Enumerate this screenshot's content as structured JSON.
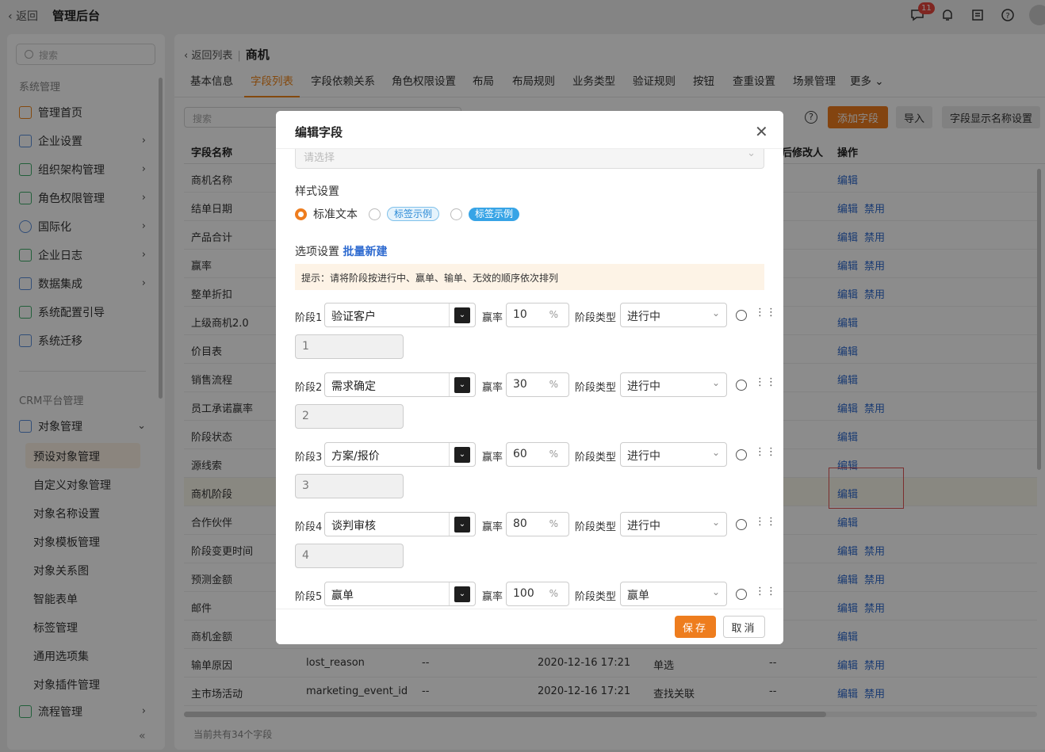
{
  "topbar": {
    "back_label": "返回",
    "app_title": "管理后台",
    "notification_count": "11"
  },
  "sidebar": {
    "search_placeholder": "搜索",
    "group_system": "系统管理",
    "system_items": [
      {
        "label": "管理首页",
        "icon": "home-icon"
      },
      {
        "label": "企业设置",
        "icon": "building-icon"
      },
      {
        "label": "组织架构管理",
        "icon": "org-icon"
      },
      {
        "label": "角色权限管理",
        "icon": "id-card-icon"
      },
      {
        "label": "国际化",
        "icon": "globe-icon"
      },
      {
        "label": "企业日志",
        "icon": "log-icon"
      },
      {
        "label": "数据集成",
        "icon": "chip-icon"
      },
      {
        "label": "系统配置引导",
        "icon": "guide-icon"
      },
      {
        "label": "系统迁移",
        "icon": "migrate-icon"
      }
    ],
    "group_crm": "CRM平台管理",
    "crm_parent": "对象管理",
    "crm_subitems": [
      "预设对象管理",
      "自定义对象管理",
      "对象名称设置",
      "对象模板管理",
      "对象关系图",
      "智能表单",
      "标签管理",
      "通用选项集",
      "对象插件管理"
    ],
    "crm_next": "流程管理"
  },
  "main": {
    "back_to_list": "返回列表",
    "entity_name": "商机",
    "tabs": [
      "基本信息",
      "字段列表",
      "字段依赖关系",
      "角色权限设置",
      "布局",
      "布局规则",
      "业务类型",
      "验证规则",
      "按钮",
      "查重设置",
      "场景管理",
      "更多"
    ],
    "search_placeholder": "搜索",
    "btn_add_field": "添加字段",
    "btn_import": "导入",
    "btn_display_name": "字段显示名称设置",
    "columns": {
      "name": "字段名称",
      "modifier": "后修改人",
      "action": "操作"
    },
    "rows": [
      {
        "name": "商机名称",
        "api": "",
        "c3": "",
        "time": "",
        "type": "",
        "mod": "",
        "edit": "编辑",
        "disable": ""
      },
      {
        "name": "结单日期",
        "api": "",
        "c3": "",
        "time": "",
        "type": "",
        "mod": "",
        "edit": "编辑",
        "disable": "禁用"
      },
      {
        "name": "产品合计",
        "api": "",
        "c3": "",
        "time": "",
        "type": "",
        "mod": "",
        "edit": "编辑",
        "disable": "禁用"
      },
      {
        "name": "赢率",
        "api": "",
        "c3": "",
        "time": "",
        "type": "",
        "mod": "",
        "edit": "编辑",
        "disable": "禁用"
      },
      {
        "name": "整单折扣",
        "api": "",
        "c3": "",
        "time": "",
        "type": "",
        "mod": "",
        "edit": "编辑",
        "disable": "禁用"
      },
      {
        "name": "上级商机2.0",
        "api": "",
        "c3": "",
        "time": "",
        "type": "",
        "mod": "",
        "edit": "编辑",
        "disable": ""
      },
      {
        "name": "价目表",
        "api": "",
        "c3": "",
        "time": "",
        "type": "",
        "mod": "",
        "edit": "编辑",
        "disable": ""
      },
      {
        "name": "销售流程",
        "api": "",
        "c3": "",
        "time": "",
        "type": "",
        "mod": "",
        "edit": "编辑",
        "disable": ""
      },
      {
        "name": "员工承诺赢率",
        "api": "",
        "c3": "",
        "time": "",
        "type": "",
        "mod": "",
        "edit": "编辑",
        "disable": "禁用"
      },
      {
        "name": "阶段状态",
        "api": "",
        "c3": "",
        "time": "",
        "type": "",
        "mod": "",
        "edit": "编辑",
        "disable": ""
      },
      {
        "name": "源线索",
        "api": "",
        "c3": "",
        "time": "",
        "type": "",
        "mod": "",
        "edit": "编辑",
        "disable": ""
      },
      {
        "name": "商机阶段",
        "api": "",
        "c3": "",
        "time": "",
        "type": "",
        "mod": "",
        "edit": "编辑",
        "disable": ""
      },
      {
        "name": "合作伙伴",
        "api": "",
        "c3": "",
        "time": "",
        "type": "",
        "mod": "",
        "edit": "编辑",
        "disable": ""
      },
      {
        "name": "阶段变更时间",
        "api": "",
        "c3": "",
        "time": "",
        "type": "",
        "mod": "",
        "edit": "编辑",
        "disable": "禁用"
      },
      {
        "name": "预测金额",
        "api": "",
        "c3": "",
        "time": "",
        "type": "",
        "mod": "",
        "edit": "编辑",
        "disable": "禁用"
      },
      {
        "name": "邮件",
        "api": "",
        "c3": "",
        "time": "",
        "type": "",
        "mod": "",
        "edit": "编辑",
        "disable": "禁用"
      },
      {
        "name": "商机金额",
        "api": "",
        "c3": "",
        "time": "",
        "type": "",
        "mod": "",
        "edit": "编辑",
        "disable": ""
      },
      {
        "name": "输单原因",
        "api": "lost_reason",
        "c3": "--",
        "time": "2020-12-16 17:21",
        "type": "单选",
        "mod": "--",
        "edit": "编辑",
        "disable": "禁用"
      },
      {
        "name": "主市场活动",
        "api": "marketing_event_id",
        "c3": "--",
        "time": "2020-12-16 17:21",
        "type": "查找关联",
        "mod": "--",
        "edit": "编辑",
        "disable": "禁用"
      }
    ],
    "footer_count": "当前共有34个字段"
  },
  "modal": {
    "title": "编辑字段",
    "prev_select_placeholder": "请选择",
    "style_label": "样式设置",
    "style_options": {
      "plain": "标准文本",
      "tag_outline": "标签示例",
      "tag_solid": "标签示例"
    },
    "options_label": "选项设置",
    "batch_create": "批量新建",
    "tip": "提示：请将阶段按进行中、赢单、输单、无效的顺序依次排列",
    "rate_label": "赢率",
    "rate_unit": "%",
    "type_label": "阶段类型",
    "stages": [
      {
        "label": "阶段1",
        "name": "验证客户",
        "rate": "10",
        "type": "进行中",
        "code": "1"
      },
      {
        "label": "阶段2",
        "name": "需求确定",
        "rate": "30",
        "type": "进行中",
        "code": "2"
      },
      {
        "label": "阶段3",
        "name": "方案/报价",
        "rate": "60",
        "type": "进行中",
        "code": "3"
      },
      {
        "label": "阶段4",
        "name": "谈判审核",
        "rate": "80",
        "type": "进行中",
        "code": "4"
      },
      {
        "label": "阶段5",
        "name": "赢单",
        "rate": "100",
        "type": "赢单",
        "code": ""
      }
    ],
    "save_label": "保存",
    "cancel_label": "取消"
  },
  "colors": {
    "accent": "#ee7d1e",
    "link": "#2f6bd0",
    "highlight_box": "#e25555"
  }
}
